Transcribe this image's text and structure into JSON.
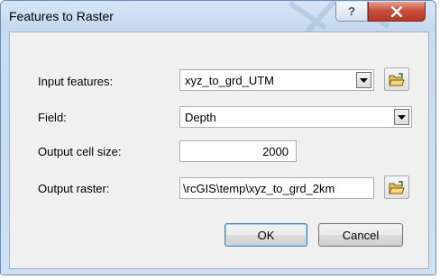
{
  "window": {
    "title": "Features to Raster"
  },
  "titlebar": {
    "help_label": "?",
    "close_label": "X"
  },
  "form": {
    "input_features": {
      "label": "Input features:",
      "value": "xyz_to_grd_UTM"
    },
    "field": {
      "label": "Field:",
      "value": "Depth"
    },
    "cell_size": {
      "label": "Output cell size:",
      "value": "2000"
    },
    "output_raster": {
      "label": "Output raster:",
      "value": "\\rcGIS\\temp\\xyz_to_grd_2km"
    }
  },
  "buttons": {
    "ok_label": "OK",
    "cancel_label": "Cancel"
  },
  "icons": {
    "help": "help-icon",
    "close": "close-icon",
    "dropdown": "chevron-down-icon",
    "folder": "open-folder-icon"
  },
  "colors": {
    "close_button": "#c94f3c",
    "titlebar": "#c3d8ee",
    "dialog_bg": "#f0f0f0"
  }
}
